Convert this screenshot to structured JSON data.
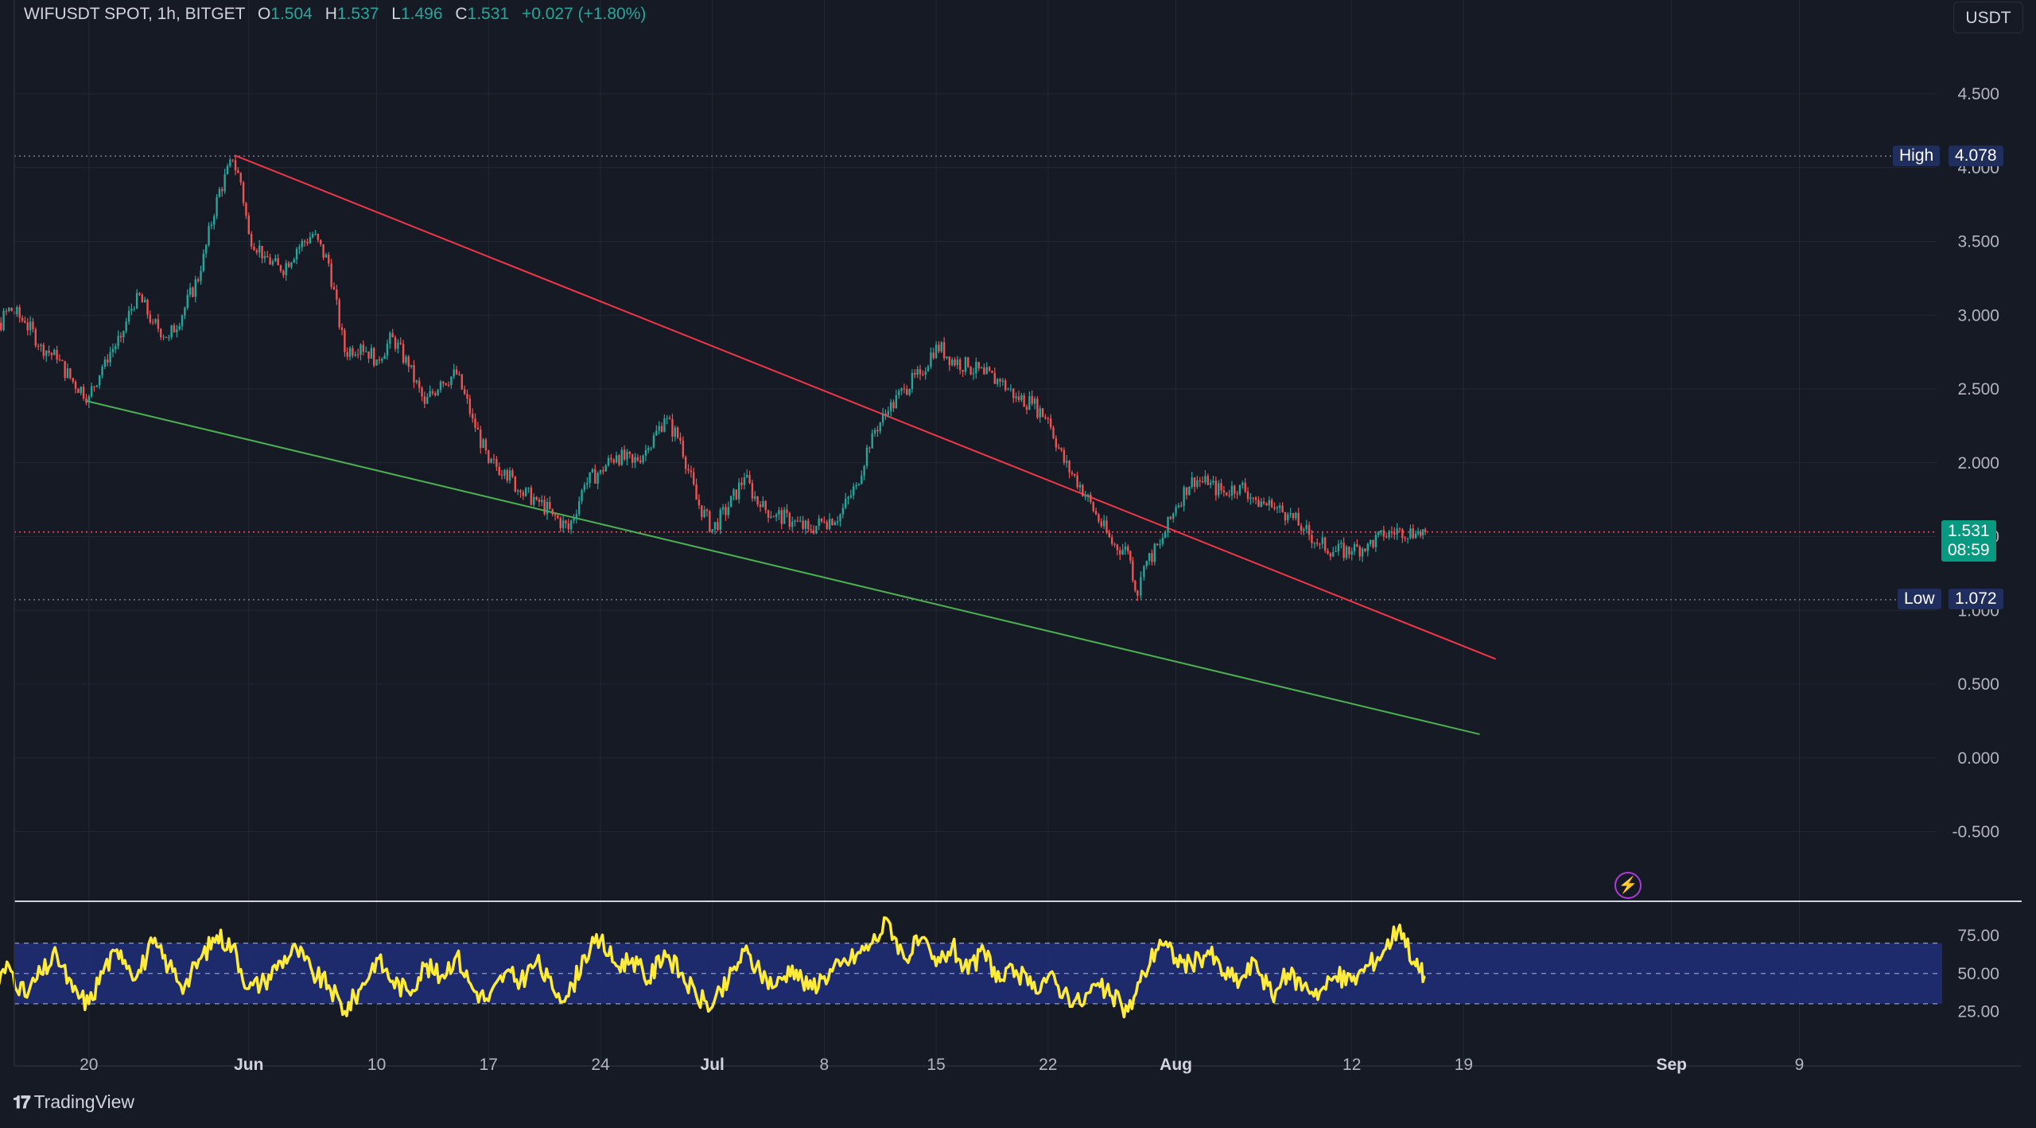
{
  "header": {
    "symbol": "WIFUSDT SPOT, 1h, BITGET",
    "o_label": "O",
    "o_value": "1.504",
    "h_label": "H",
    "h_value": "1.537",
    "l_label": "L",
    "l_value": "1.496",
    "c_label": "C",
    "c_value": "1.531",
    "change": "+0.027 (+1.80%)",
    "currency": "USDT"
  },
  "markers": {
    "high_label": "High",
    "high_value": "4.078",
    "low_label": "Low",
    "low_value": "1.072",
    "last_price": "1.531",
    "countdown": "08:59"
  },
  "colors": {
    "up": "#26a69a",
    "down": "#ef5350",
    "resistance": "#f23645",
    "support": "#4caf50",
    "rsi_line": "#ffeb3b",
    "rsi_band": "#1e2e78"
  },
  "brand": "TradingView",
  "icons": {
    "logo": "tradingview-logo-icon",
    "alert": "lightning-alert-icon"
  },
  "chart_data": [
    {
      "type": "line",
      "title": "",
      "yticks": [
        "4.500",
        "4.000",
        "3.500",
        "3.000",
        "2.500",
        "2.000",
        "1.500",
        "1.000",
        "0.500",
        "0.000",
        "-0.500"
      ],
      "ylim": [
        -0.5,
        4.5
      ],
      "xticks": [
        "20",
        "Jun",
        "10",
        "17",
        "24",
        "Jul",
        "8",
        "15",
        "22",
        "Aug",
        "12",
        "19",
        "Sep",
        "9"
      ],
      "xtick_positions": [
        -2,
        8,
        16,
        23,
        30,
        37,
        44,
        51,
        58,
        66,
        77,
        84,
        97,
        105
      ],
      "series": [
        {
          "values": [
            [
              -10,
              2.9
            ],
            [
              -9,
              3.1
            ],
            [
              -8,
              2.85
            ],
            [
              -7,
              3.05
            ],
            [
              -6,
              2.95
            ],
            [
              -5,
              2.8
            ],
            [
              -4,
              2.7
            ],
            [
              -3,
              2.55
            ],
            [
              -2,
              2.45
            ],
            [
              -1,
              2.7
            ],
            [
              0,
              2.85
            ],
            [
              1,
              3.15
            ],
            [
              2,
              2.95
            ],
            [
              3,
              2.85
            ],
            [
              4,
              3.05
            ],
            [
              5,
              3.3
            ],
            [
              6,
              3.8
            ],
            [
              7,
              4.05
            ],
            [
              7.5,
              3.9
            ],
            [
              8,
              3.55
            ],
            [
              9,
              3.4
            ],
            [
              10,
              3.3
            ],
            [
              11,
              3.45
            ],
            [
              12,
              3.55
            ],
            [
              13,
              3.35
            ],
            [
              14,
              2.75
            ],
            [
              15,
              2.8
            ],
            [
              16,
              2.7
            ],
            [
              17,
              2.85
            ],
            [
              18,
              2.65
            ],
            [
              19,
              2.4
            ],
            [
              20,
              2.55
            ],
            [
              21,
              2.6
            ],
            [
              22,
              2.3
            ],
            [
              23,
              2.0
            ],
            [
              24,
              1.95
            ],
            [
              25,
              1.8
            ],
            [
              26,
              1.75
            ],
            [
              27,
              1.65
            ],
            [
              28,
              1.55
            ],
            [
              29,
              1.85
            ],
            [
              30,
              1.95
            ],
            [
              31,
              2.05
            ],
            [
              32,
              2.0
            ],
            [
              33,
              2.1
            ],
            [
              34,
              2.3
            ],
            [
              35,
              2.15
            ],
            [
              36,
              1.75
            ],
            [
              37,
              1.55
            ],
            [
              38,
              1.7
            ],
            [
              39,
              1.9
            ],
            [
              40,
              1.7
            ],
            [
              41,
              1.65
            ],
            [
              42,
              1.6
            ],
            [
              43,
              1.55
            ],
            [
              44,
              1.6
            ],
            [
              45,
              1.65
            ],
            [
              46,
              1.85
            ],
            [
              47,
              2.2
            ],
            [
              48,
              2.35
            ],
            [
              49,
              2.5
            ],
            [
              50,
              2.6
            ],
            [
              51,
              2.8
            ],
            [
              52,
              2.7
            ],
            [
              53,
              2.65
            ],
            [
              54,
              2.6
            ],
            [
              55,
              2.55
            ],
            [
              56,
              2.45
            ],
            [
              57,
              2.4
            ],
            [
              58,
              2.3
            ],
            [
              59,
              2.0
            ],
            [
              60,
              1.85
            ],
            [
              61,
              1.65
            ],
            [
              62,
              1.45
            ],
            [
              63,
              1.4
            ],
            [
              63.6,
              1.1
            ],
            [
              64,
              1.3
            ],
            [
              65,
              1.45
            ],
            [
              66,
              1.7
            ],
            [
              67,
              1.9
            ],
            [
              68,
              1.85
            ],
            [
              69,
              1.8
            ],
            [
              70,
              1.85
            ],
            [
              71,
              1.75
            ],
            [
              72,
              1.7
            ],
            [
              73,
              1.65
            ],
            [
              74,
              1.55
            ],
            [
              75,
              1.45
            ],
            [
              76,
              1.4
            ],
            [
              77,
              1.4
            ],
            [
              78,
              1.45
            ],
            [
              79,
              1.5
            ],
            [
              80,
              1.55
            ],
            [
              81,
              1.52
            ],
            [
              81.6,
              1.531
            ]
          ]
        }
      ],
      "trendlines": [
        {
          "name": "resistance",
          "from": [
            7.2,
            4.08
          ],
          "to": [
            86,
            0.67
          ]
        },
        {
          "name": "support",
          "from": [
            -2.2,
            2.42
          ],
          "to": [
            85,
            0.16
          ]
        }
      ],
      "levels": [
        {
          "name": "high",
          "y": 4.078
        },
        {
          "name": "low",
          "y": 1.072
        },
        {
          "name": "last",
          "y": 1.531
        }
      ]
    },
    {
      "type": "line",
      "title": "",
      "yticks": [
        "75.00",
        "50.00",
        "25.00"
      ],
      "ylim": [
        10,
        95
      ],
      "band": [
        30,
        70
      ],
      "series": [
        {
          "values": [
            [
              -10,
              45
            ],
            [
              -9,
              60
            ],
            [
              -8,
              40
            ],
            [
              -7,
              55
            ],
            [
              -6,
              35
            ],
            [
              -5,
              50
            ],
            [
              -4,
              62
            ],
            [
              -3,
              38
            ],
            [
              -2,
              30
            ],
            [
              -1,
              55
            ],
            [
              0,
              65
            ],
            [
              1,
              48
            ],
            [
              2,
              70
            ],
            [
              3,
              55
            ],
            [
              4,
              42
            ],
            [
              5,
              60
            ],
            [
              6,
              75
            ],
            [
              7,
              68
            ],
            [
              8,
              40
            ],
            [
              9,
              45
            ],
            [
              10,
              58
            ],
            [
              11,
              66
            ],
            [
              12,
              50
            ],
            [
              13,
              42
            ],
            [
              14,
              25
            ],
            [
              15,
              40
            ],
            [
              16,
              60
            ],
            [
              17,
              45
            ],
            [
              18,
              38
            ],
            [
              19,
              55
            ],
            [
              20,
              48
            ],
            [
              21,
              62
            ],
            [
              22,
              40
            ],
            [
              23,
              32
            ],
            [
              24,
              50
            ],
            [
              25,
              45
            ],
            [
              26,
              58
            ],
            [
              27,
              40
            ],
            [
              28,
              35
            ],
            [
              29,
              62
            ],
            [
              30,
              72
            ],
            [
              31,
              55
            ],
            [
              32,
              60
            ],
            [
              33,
              45
            ],
            [
              34,
              65
            ],
            [
              35,
              50
            ],
            [
              36,
              35
            ],
            [
              37,
              28
            ],
            [
              38,
              45
            ],
            [
              39,
              65
            ],
            [
              40,
              50
            ],
            [
              41,
              42
            ],
            [
              42,
              55
            ],
            [
              43,
              40
            ],
            [
              44,
              48
            ],
            [
              45,
              55
            ],
            [
              46,
              62
            ],
            [
              47,
              70
            ],
            [
              48,
              85
            ],
            [
              49,
              60
            ],
            [
              50,
              72
            ],
            [
              51,
              55
            ],
            [
              52,
              68
            ],
            [
              53,
              50
            ],
            [
              54,
              65
            ],
            [
              55,
              45
            ],
            [
              56,
              52
            ],
            [
              57,
              40
            ],
            [
              58,
              48
            ],
            [
              59,
              38
            ],
            [
              60,
              30
            ],
            [
              61,
              42
            ],
            [
              62,
              35
            ],
            [
              63,
              25
            ],
            [
              64,
              50
            ],
            [
              65,
              72
            ],
            [
              66,
              60
            ],
            [
              67,
              55
            ],
            [
              68,
              65
            ],
            [
              69,
              50
            ],
            [
              70,
              45
            ],
            [
              71,
              58
            ],
            [
              72,
              35
            ],
            [
              73,
              50
            ],
            [
              74,
              42
            ],
            [
              75,
              38
            ],
            [
              76,
              48
            ],
            [
              77,
              45
            ],
            [
              78,
              55
            ],
            [
              79,
              65
            ],
            [
              80,
              82
            ],
            [
              81,
              55
            ],
            [
              81.6,
              48
            ]
          ]
        }
      ]
    }
  ]
}
